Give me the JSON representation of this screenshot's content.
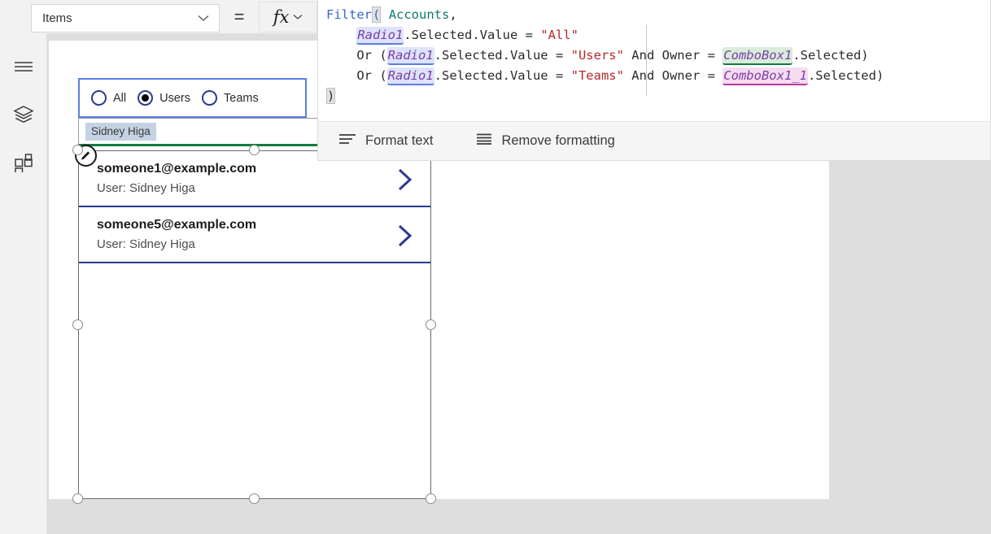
{
  "topbar": {
    "property_dropdown": {
      "value": "Items",
      "icon": "chevron-down-icon"
    },
    "equals_sign": "=",
    "fx_button": {
      "label": "fx",
      "icon": "chevron-down-icon"
    }
  },
  "rail": {
    "items": [
      {
        "name": "menu-icon",
        "label": "Menu"
      },
      {
        "name": "tree-view-icon",
        "label": "Tree view"
      },
      {
        "name": "insert-icon",
        "label": "Insert"
      }
    ]
  },
  "formula": {
    "lines": [
      [
        {
          "t": "Filter",
          "c": "tk-fn"
        },
        {
          "t": "(",
          "c": "tk-fn hl-paren"
        },
        {
          "t": " ",
          "c": "tk-plain"
        },
        {
          "t": "Accounts",
          "c": "tk-tbl"
        },
        {
          "t": ",",
          "c": "tk-plain"
        }
      ],
      [
        {
          "t": "    ",
          "c": "tk-plain"
        },
        {
          "t": "Radio1",
          "c": "tk-id hl-radio"
        },
        {
          "t": ".Selected.Value ",
          "c": "tk-plain"
        },
        {
          "t": "= ",
          "c": "tk-op"
        },
        {
          "t": "\"All\"",
          "c": "tk-str"
        }
      ],
      [
        {
          "t": "    Or (",
          "c": "tk-plain"
        },
        {
          "t": "Radio1",
          "c": "tk-id hl-radio"
        },
        {
          "t": ".Selected.Value ",
          "c": "tk-plain"
        },
        {
          "t": "= ",
          "c": "tk-op"
        },
        {
          "t": "\"Users\"",
          "c": "tk-str"
        },
        {
          "t": " And Owner ",
          "c": "tk-plain"
        },
        {
          "t": "= ",
          "c": "tk-op"
        },
        {
          "t": "ComboBox1",
          "c": "tk-id hl-cb1"
        },
        {
          "t": ".Selected)",
          "c": "tk-plain"
        }
      ],
      [
        {
          "t": "    Or (",
          "c": "tk-plain"
        },
        {
          "t": "Radio1",
          "c": "tk-id hl-radio"
        },
        {
          "t": ".Selected.Value ",
          "c": "tk-plain"
        },
        {
          "t": "= ",
          "c": "tk-op"
        },
        {
          "t": "\"Teams\"",
          "c": "tk-str"
        },
        {
          "t": " And Owner ",
          "c": "tk-plain"
        },
        {
          "t": "= ",
          "c": "tk-op"
        },
        {
          "t": "ComboBox1_1",
          "c": "tk-id hl-cb2"
        },
        {
          "t": ".Selected)",
          "c": "tk-plain"
        }
      ],
      [
        {
          "t": ")",
          "c": "tk-plain hl-paren"
        }
      ]
    ],
    "plain_text": "Filter( Accounts,\n    Radio1.Selected.Value = \"All\"\n    Or (Radio1.Selected.Value = \"Users\" And Owner = ComboBox1.Selected)\n    Or (Radio1.Selected.Value = \"Teams\" And Owner = ComboBox1_1.Selected)\n)"
  },
  "format_bar": {
    "format_text": {
      "label": "Format text",
      "icon": "format-text-icon"
    },
    "remove_formatting": {
      "label": "Remove formatting",
      "icon": "remove-formatting-icon"
    }
  },
  "canvas": {
    "radio_group": {
      "name": "Radio1",
      "selected": "Users",
      "options": [
        {
          "label": "All",
          "selected": false
        },
        {
          "label": "Users",
          "selected": true
        },
        {
          "label": "Teams",
          "selected": false
        }
      ]
    },
    "combobox": {
      "name": "ComboBox1",
      "selected_chip": "Sidney Higa"
    },
    "gallery": {
      "badge_icon": "edit-pencil-icon",
      "items": [
        {
          "title": "someone1@example.com",
          "subtitle": "User: Sidney Higa",
          "chevron": "chevron-right-icon"
        },
        {
          "title": "someone5@example.com",
          "subtitle": "User: Sidney Higa",
          "chevron": "chevron-right-icon"
        }
      ]
    }
  },
  "colors": {
    "accent_blue": "#5b7fe0",
    "combobox_green": "#107c41",
    "combobox_pink": "#b8399b",
    "chevron_navy": "#2b3a8f",
    "string_red": "#b5292b",
    "function_blue": "#3a66c4",
    "table_teal": "#0f7a6e",
    "identifier_purple": "#7a3fa8"
  }
}
